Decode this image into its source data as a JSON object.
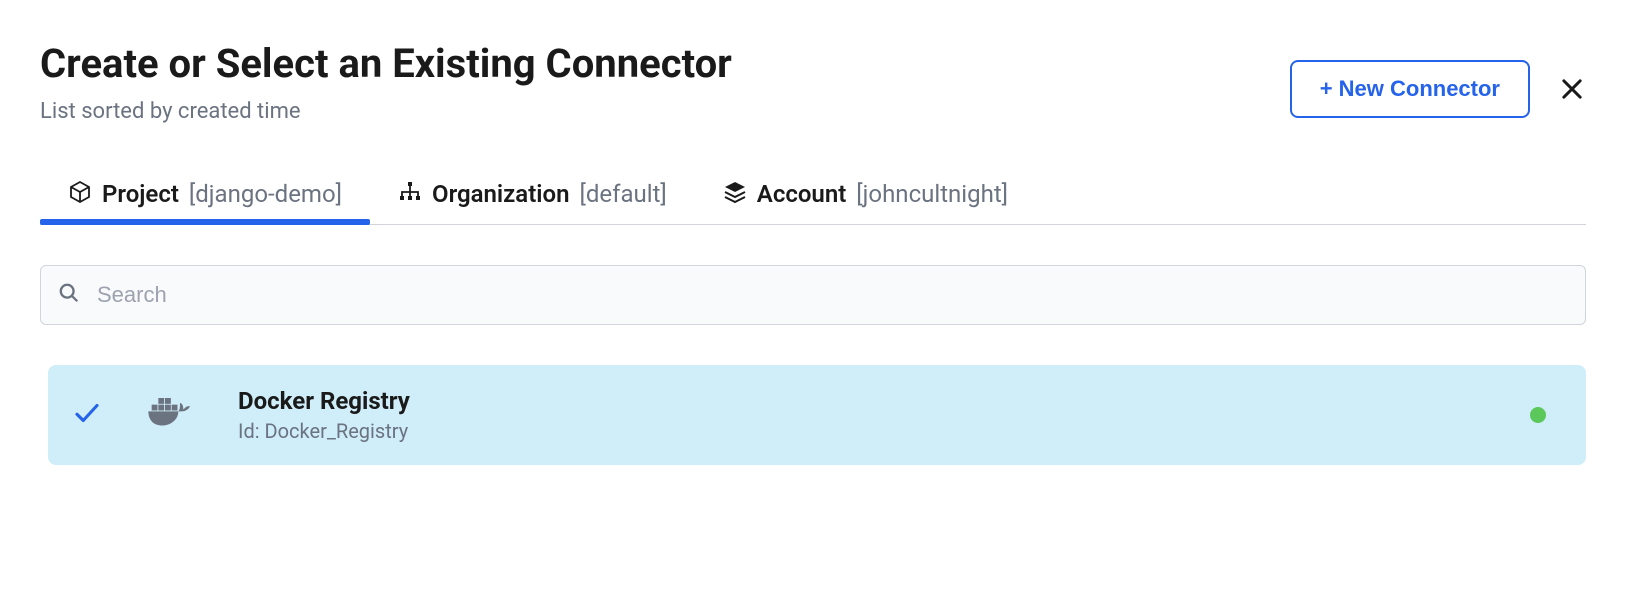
{
  "header": {
    "title": "Create or Select an Existing Connector",
    "subtitle": "List sorted by created time",
    "new_connector_label": "+ New Connector"
  },
  "tabs": {
    "project": {
      "label": "Project",
      "value": "[django-demo]"
    },
    "organization": {
      "label": "Organization",
      "value": "[default]"
    },
    "account": {
      "label": "Account",
      "value": "[johncultnight]"
    }
  },
  "search": {
    "placeholder": "Search"
  },
  "connectors": [
    {
      "name": "Docker Registry",
      "id_label": "Id: Docker_Registry",
      "selected": true,
      "status": "green",
      "icon": "docker"
    }
  ]
}
